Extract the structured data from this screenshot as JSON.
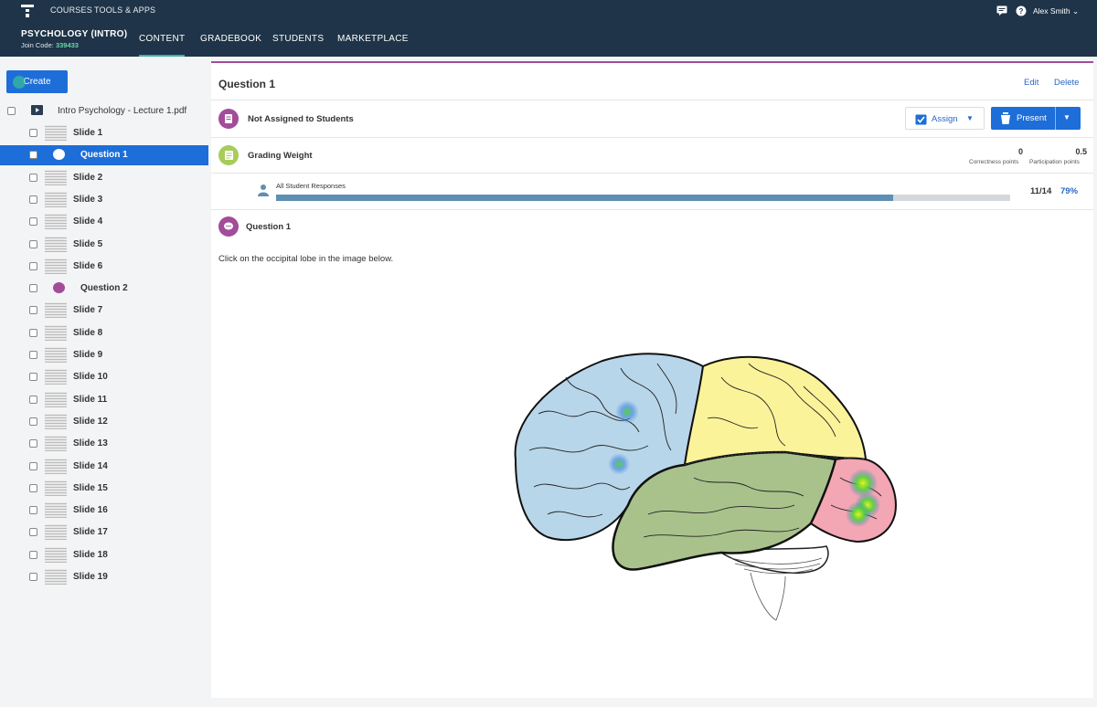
{
  "topbar": {
    "links": [
      "COURSES",
      "TOOLS & APPS"
    ],
    "course_title": "PSYCHOLOGY (INTRO)",
    "join_label": "Join Code:",
    "join_code": "339433",
    "tabs": [
      {
        "label": "CONTENT",
        "active": true
      },
      {
        "label": "GRADEBOOK",
        "active": false
      },
      {
        "label": "STUDENTS",
        "active": false
      },
      {
        "label": "MARKETPLACE",
        "active": false
      }
    ],
    "user_name": "Alex Smith"
  },
  "sidebar": {
    "create_label": "Create",
    "file_name": "Intro Psychology - Lecture 1.pdf",
    "items": [
      {
        "label": "Slide 1",
        "kind": "slide"
      },
      {
        "label": "Question 1",
        "kind": "question",
        "selected": true
      },
      {
        "label": "Slide 2",
        "kind": "slide"
      },
      {
        "label": "Slide 3",
        "kind": "slide"
      },
      {
        "label": "Slide 4",
        "kind": "slide"
      },
      {
        "label": "Slide 5",
        "kind": "slide"
      },
      {
        "label": "Slide 6",
        "kind": "slide"
      },
      {
        "label": "Question 2",
        "kind": "question"
      },
      {
        "label": "Slide 7",
        "kind": "slide"
      },
      {
        "label": "Slide 8",
        "kind": "slide"
      },
      {
        "label": "Slide 9",
        "kind": "slide"
      },
      {
        "label": "Slide 10",
        "kind": "slide"
      },
      {
        "label": "Slide 11",
        "kind": "slide"
      },
      {
        "label": "Slide 12",
        "kind": "slide"
      },
      {
        "label": "Slide 13",
        "kind": "slide"
      },
      {
        "label": "Slide 14",
        "kind": "slide"
      },
      {
        "label": "Slide 15",
        "kind": "slide"
      },
      {
        "label": "Slide 16",
        "kind": "slide"
      },
      {
        "label": "Slide 17",
        "kind": "slide"
      },
      {
        "label": "Slide 18",
        "kind": "slide"
      },
      {
        "label": "Slide 19",
        "kind": "slide"
      }
    ]
  },
  "main": {
    "title": "Question 1",
    "edit_label": "Edit",
    "delete_label": "Delete",
    "status_label": "Not Assigned to Students",
    "assign_label": "Assign",
    "present_label": "Present",
    "grading_label": "Grading Weight",
    "correctness_value": "0",
    "correctness_label": "Correctness points",
    "participation_value": "0.5",
    "participation_label": "Participation points",
    "responses_label": "All Student Responses",
    "responses_count": "11/14",
    "responses_percent": "79%",
    "response_fraction": 0.84,
    "question_label": "Question 1",
    "prompt": "Click on the occipital lobe in the image below."
  },
  "colors": {
    "topbar": "#1f3448",
    "accent_blue": "#1d6ed8",
    "question_purple": "#a24c9a",
    "grading_green": "#a8cc5a",
    "frontal": "#b8d6ea",
    "parietal": "#fbf39a",
    "temporal": "#a9c28c",
    "occipital": "#f3a6b4"
  }
}
